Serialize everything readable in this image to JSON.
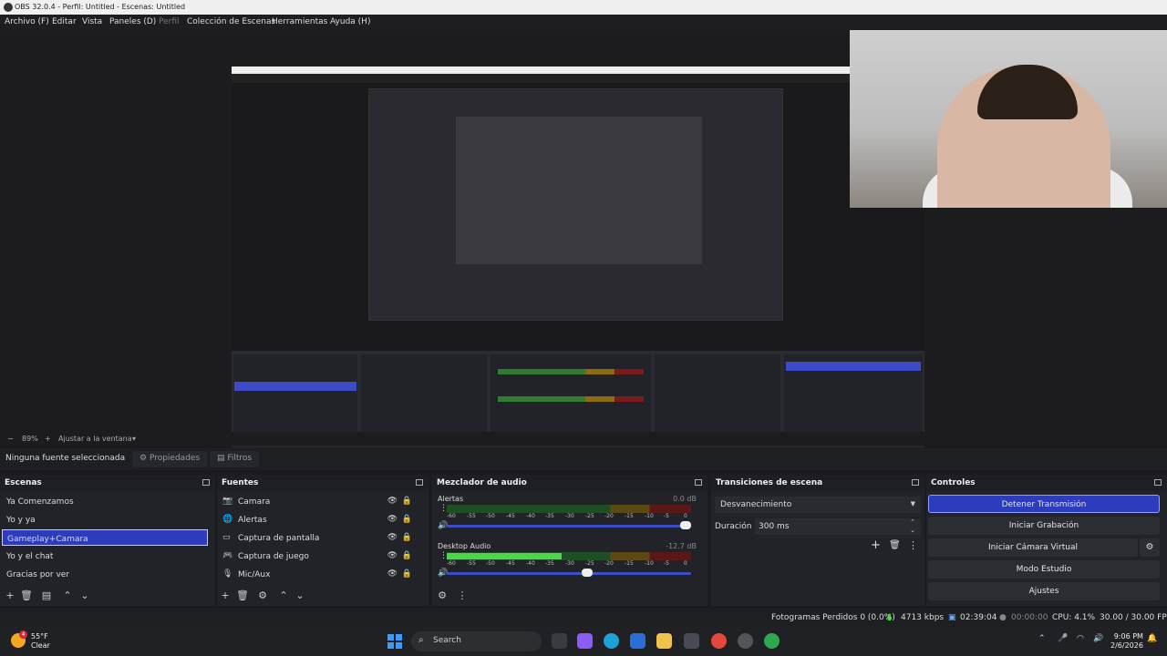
{
  "window": {
    "title": "OBS 32.0.4 - Perfil: Untitled - Escenas: Untitled"
  },
  "menu": {
    "items": [
      "Archivo (F)",
      "Editar",
      "Vista",
      "Paneles (D)",
      "Perfil",
      "Colección de Escenas",
      "Herramientas",
      "Ayuda (H)"
    ]
  },
  "zoom": {
    "minus": "−",
    "value": "89%",
    "plus": "+",
    "fit": "Ajustar a la ventana"
  },
  "source_bar": {
    "none_selected": "Ninguna fuente seleccionada",
    "properties": "Propiedades",
    "filters": "Filtros"
  },
  "scenes": {
    "title": "Escenas",
    "items": [
      "Ya Comenzamos",
      "Yo y ya",
      "Gameplay+Camara",
      "Yo y el chat",
      "Gracias por ver"
    ],
    "selected_index": 2
  },
  "sources": {
    "title": "Fuentes",
    "items": [
      {
        "name": "Camara",
        "icon": "camera-icon"
      },
      {
        "name": "Alertas",
        "icon": "globe-icon"
      },
      {
        "name": "Captura de pantalla",
        "icon": "monitor-icon"
      },
      {
        "name": "Captura de juego",
        "icon": "gamepad-icon"
      },
      {
        "name": "Mic/Aux",
        "icon": "mic-icon"
      }
    ]
  },
  "mixer": {
    "title": "Mezclador de audio",
    "channels": [
      {
        "name": "Alertas",
        "db": "0.0 dB",
        "level": 0.0,
        "volume": 1.0
      },
      {
        "name": "Desktop Audio",
        "db": "-12.7 dB",
        "level": 0.47,
        "volume": 0.58
      }
    ],
    "scale": [
      "-60",
      "-55",
      "-50",
      "-45",
      "-40",
      "-35",
      "-30",
      "-25",
      "-20",
      "-15",
      "-10",
      "-5",
      "0"
    ]
  },
  "transitions": {
    "title": "Transiciones de escena",
    "selected": "Desvanecimiento",
    "duration_label": "Duración",
    "duration_value": "300 ms"
  },
  "controls": {
    "title": "Controles",
    "buttons": [
      "Detener Transmisión",
      "Iniciar Grabación",
      "Iniciar Cámara Virtual",
      "Modo Estudio",
      "Ajustes"
    ]
  },
  "status": {
    "dropped": "Fotogramas Perdidos 0 (0.0%)",
    "bitrate": "4713 kbps",
    "stream_time": "02:39:04",
    "rec_time": "00:00:00",
    "cpu": "CPU: 4.1%",
    "fps": "30.00 / 30.00 FPS"
  },
  "taskbar": {
    "temp": "55°F",
    "cond": "Clear",
    "badge": "4",
    "search": "Search",
    "time": "9:06 PM",
    "date": "2/6/2026"
  },
  "colors": {
    "accent": "#2d3bbd",
    "meter_green": "#4cd64c",
    "panel": "#222329"
  }
}
